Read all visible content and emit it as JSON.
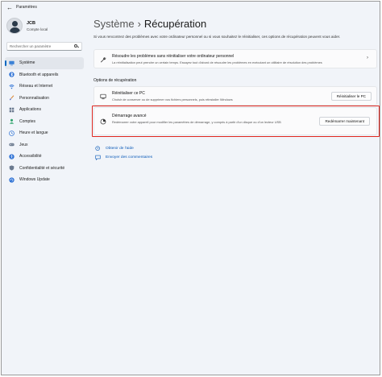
{
  "window": {
    "title": "Paramètres"
  },
  "profile": {
    "name": "JCB",
    "subtitle": "Compte local"
  },
  "search": {
    "placeholder": "Rechercher un paramètre"
  },
  "sidebar": {
    "items": [
      {
        "label": "Système",
        "icon": "system-icon",
        "active": true
      },
      {
        "label": "Bluetooth et appareils",
        "icon": "bluetooth-icon"
      },
      {
        "label": "Réseau et Internet",
        "icon": "network-icon"
      },
      {
        "label": "Personnalisation",
        "icon": "brush-icon"
      },
      {
        "label": "Applications",
        "icon": "apps-icon"
      },
      {
        "label": "Comptes",
        "icon": "account-icon"
      },
      {
        "label": "Heure et langue",
        "icon": "clock-icon"
      },
      {
        "label": "Jeux",
        "icon": "gamepad-icon"
      },
      {
        "label": "Accessibilité",
        "icon": "accessibility-icon"
      },
      {
        "label": "Confidentialité et sécurité",
        "icon": "shield-icon"
      },
      {
        "label": "Windows Update",
        "icon": "update-icon"
      }
    ]
  },
  "header": {
    "breadcrumb": "Système",
    "separator": "›",
    "title": "Récupération"
  },
  "intro": "Si vous rencontrez des problèmes avec votre ordinateur personnel ou si vous souhaitez le réinitialiser, ces options de récupération peuvent vous aider.",
  "fix_card": {
    "title": "Résoudre les problèmes sans réinitialiser votre ordinateur personnel",
    "description": "La réinitialisation peut prendre un certain temps. Essayez tout d'abord de résoudre les problèmes en exécutant un utilitaire de résolution des problèmes",
    "chevron": "›"
  },
  "recovery_options": {
    "label": "Options de récupération",
    "reset": {
      "title": "Réinitialiser ce PC",
      "description": "Choisir de conserver ou de supprimer vos fichiers personnels, puis réinstaller Windows",
      "button": "Réinitialiser le PC"
    },
    "advanced": {
      "title": "Démarrage avancé",
      "description": "Redémarrer votre appareil pour modifier les paramètres de démarrage, y compris à partir d'un disque ou d'un lecteur USB",
      "button": "Redémarrer maintenant"
    }
  },
  "links": {
    "help": "Obtenir de l'aide",
    "feedback": "Envoyer des commentaires"
  },
  "colors": {
    "accent": "#0067c0",
    "highlight": "#e0271f",
    "link": "#0b5ab8"
  }
}
